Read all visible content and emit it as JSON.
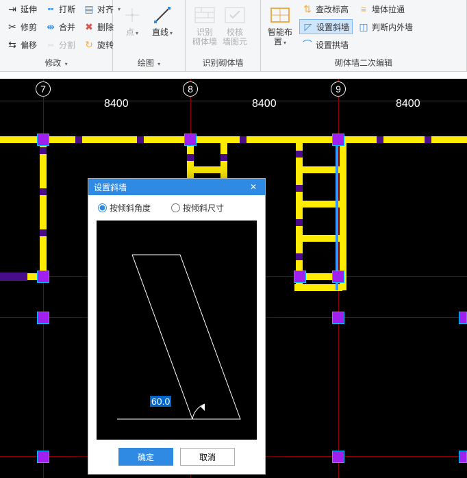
{
  "ribbon": {
    "modify": {
      "label": "修改",
      "extend": "延伸",
      "break": "打断",
      "align": "对齐",
      "trim": "修剪",
      "merge": "合并",
      "delete": "删除",
      "offset": "偏移",
      "split": "分割",
      "rotate": "旋转"
    },
    "draw": {
      "label": "绘图",
      "point": "点",
      "line": "直线"
    },
    "recognize": {
      "label": "识别砌体墙",
      "recog_wall": "识别\n砌体墙",
      "check_elem": "校核\n墙图元"
    },
    "secondary": {
      "label": "砌体墙二次编辑",
      "smart_layout": "智能布置",
      "check_elev": "查改标高",
      "wall_through": "墙体拉通",
      "set_slant": "设置斜墙",
      "check_inout": "判断内外墙",
      "set_arch": "设置拱墙"
    }
  },
  "canvas": {
    "axes": [
      "7",
      "8",
      "9"
    ],
    "dims": [
      "8400",
      "8400",
      "8400"
    ]
  },
  "dialog": {
    "title": "设置斜墙",
    "radio_angle": "按倾斜角度",
    "radio_size": "按倾斜尺寸",
    "value": "60.0",
    "ok": "确定",
    "cancel": "取消"
  }
}
